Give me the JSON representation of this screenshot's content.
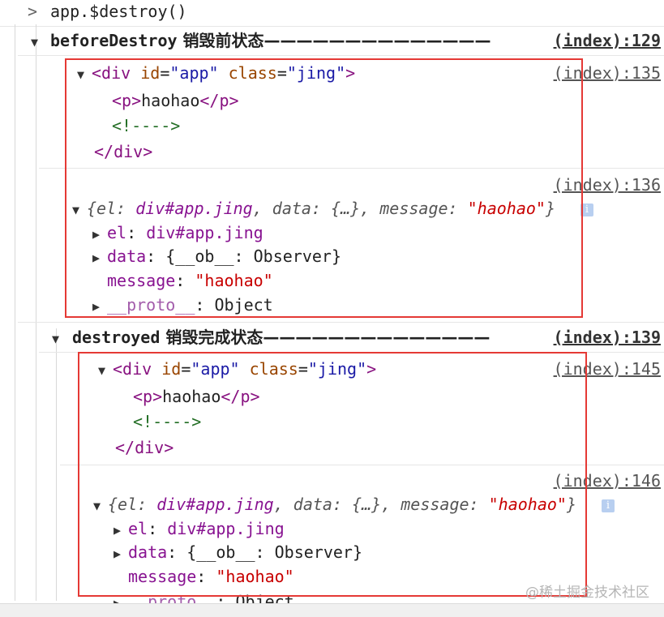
{
  "console": {
    "command": "app.$destroy()",
    "groups": [
      {
        "title_method": "beforeDestroy",
        "title_text": " 销毁前状态——————————————",
        "source": "(index):129",
        "html_source": "(index):135",
        "obj_source": "(index):136"
      },
      {
        "title_method": "destroyed",
        "title_text": " 销毁完成状态——————————————",
        "source": "(index):139",
        "html_source": "(index):145",
        "obj_source": "(index):146"
      }
    ],
    "dom": {
      "open_tag": "div",
      "attr_id": "id",
      "val_id": "\"app\"",
      "attr_class": "class",
      "val_class": "\"jing\"",
      "child_tag": "p",
      "child_text": "haohao",
      "comment": "<!---->",
      "close": "</div>"
    },
    "obj": {
      "summary_pre": "{",
      "summary_el_key": "el: ",
      "summary_el_val": "div#app.jing",
      "summary_data_key": ", data: ",
      "summary_data_val": "{…}",
      "summary_msg_key": ", message: ",
      "summary_msg_val": "\"haohao\"",
      "summary_post": "}",
      "el_key": "el",
      "el_val": "div#app.jing",
      "data_key": "data",
      "data_val": "{__ob__: Observer}",
      "msg_key": "message",
      "msg_val": "\"haohao\"",
      "proto_key": "__proto__",
      "proto_val": "Object",
      "proto_val_cut": ": Object"
    },
    "info_glyph": "i",
    "watermark": "@稀土掘金技术社区"
  }
}
